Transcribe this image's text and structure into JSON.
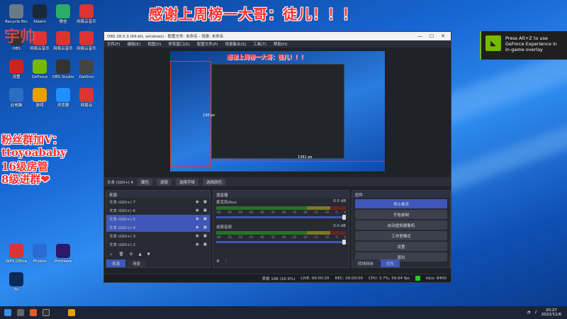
{
  "banner": "感谢上周榜一大哥：徒儿！！！",
  "corner_text": "宇帅",
  "side_text": [
    "粉丝群加V：",
    "ttoyoababy",
    "16级房管",
    "8级进群❤"
  ],
  "desktop_icons": [
    {
      "label": "Recycle Bin",
      "color": "#6a7a8a"
    },
    {
      "label": "Steam",
      "color": "#1b2838"
    },
    {
      "label": "微信",
      "color": "#2aae67"
    },
    {
      "label": "网易云音乐",
      "color": "#d33"
    },
    {
      "label": "OBS",
      "color": "#333"
    },
    {
      "label": "网易云音乐",
      "color": "#d33"
    },
    {
      "label": "网易云音乐",
      "color": "#d33"
    },
    {
      "label": "网易云音乐",
      "color": "#d33"
    },
    {
      "label": "设置",
      "color": "#c22"
    },
    {
      "label": "GeForce",
      "color": "#76b900"
    },
    {
      "label": "OBS Studio",
      "color": "#333"
    },
    {
      "label": "DaVinci",
      "color": "#444"
    },
    {
      "label": "此电脑",
      "color": "#2b6cc4"
    },
    {
      "label": "游戏",
      "color": "#e8a000"
    },
    {
      "label": "浏览器",
      "color": "#1e90ff"
    },
    {
      "label": "网易云",
      "color": "#d33"
    },
    {
      "label": "WPS Office",
      "color": "#d33"
    },
    {
      "label": "Photos",
      "color": "#2a6cd4"
    },
    {
      "label": "Premiere",
      "color": "#2a1a6a"
    },
    {
      "label": "Ps",
      "color": "#0a2a5a"
    }
  ],
  "obs": {
    "title": "OBS 28.0.3 (64-bit, windows) - 配置文件: 未命名 - 场景: 未命名",
    "menu": [
      "文件(F)",
      "编辑(E)",
      "视图(V)",
      "停靠窗口(D)",
      "配置文件(P)",
      "场景集合(S)",
      "工具(T)",
      "帮助(H)"
    ],
    "preview": {
      "text": "感谢上周榜一大哥：徒儿！！！",
      "guide_h": "1361 px",
      "guide_v": "130 px"
    },
    "source_bar": {
      "name": "文本 (GDI+) 4",
      "buttons": [
        "属性",
        "滤镜",
        "选择字体",
        "选择颜色"
      ]
    },
    "sources": {
      "header": "来源",
      "items": [
        "文本 (GDI+) 7",
        "文本 (GDI+) 6",
        "文本 (GDI+) 5",
        "文本 (GDI+) 4",
        "文本 (GDI+) 3",
        "文本 (GDI+) 2"
      ],
      "selected": [
        2,
        3
      ]
    },
    "mixer": {
      "header": "混音器",
      "tracks": [
        {
          "name": "麦克风/Aux",
          "db": "0.0 dB"
        },
        {
          "name": "桌面音频",
          "db": "0.0 dB"
        }
      ],
      "ticks": [
        "-60",
        "-55",
        "-50",
        "-45",
        "-40",
        "-35",
        "-30",
        "-25",
        "-20",
        "-15",
        "-10",
        "-5",
        "0"
      ]
    },
    "controls": {
      "header": "控件",
      "buttons": [
        "停止推流",
        "开始录制",
        "启动虚拟摄像机",
        "工作室模式",
        "设置",
        "退出"
      ]
    },
    "tabs_left": [
      "来源",
      "场景"
    ],
    "tabs_right": [
      "转场特效",
      "控件"
    ],
    "status": {
      "dropped": "丢帧 196 (16.9%)",
      "live": "LIVE: 00:00:20",
      "rec": "REC: 00:00:00",
      "cpu": "CPU: 3.7%, 59.94 fps",
      "kbps": "kb/s: 8400"
    }
  },
  "notify": {
    "text": "Press Alt+Z to use GeForce Experience in in-game overlay"
  },
  "clock": {
    "time": "20:27",
    "date": "2022/11/6"
  }
}
